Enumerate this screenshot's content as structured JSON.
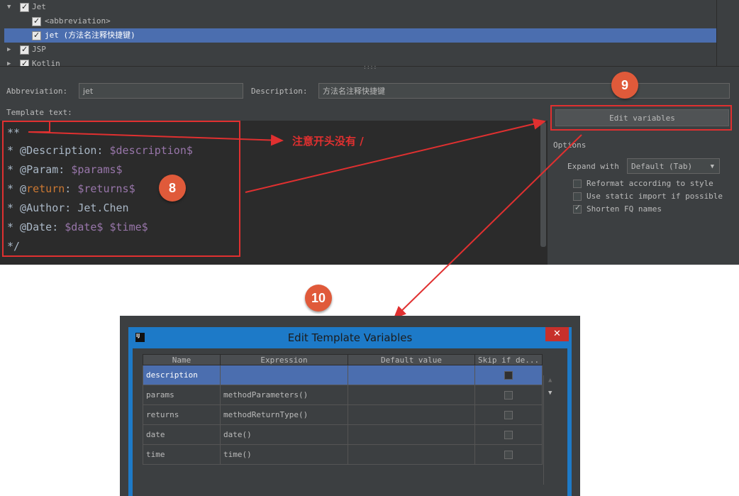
{
  "tree": {
    "items": [
      {
        "label": "Jet",
        "checked": true,
        "expanded": true
      },
      {
        "label": "<abbreviation>",
        "checked": true
      },
      {
        "label": "jet (方法名注释快捷键)",
        "checked": true,
        "selected": true
      },
      {
        "label": "JSP",
        "checked": true,
        "expanded": false
      },
      {
        "label": "Kotlin",
        "checked": true,
        "expanded": false
      }
    ],
    "divider_grip": "::::"
  },
  "form": {
    "abbreviation_label": "Abbreviation:",
    "abbreviation_value": "jet",
    "description_label": "Description:",
    "description_value": "方法名注释快捷键",
    "template_text_label": "Template text:"
  },
  "template": {
    "line1": "**",
    "line2_prefix": "* @Description: ",
    "line2_var": "$description$",
    "line3_prefix": "* @Param: ",
    "line3_var": "$params$",
    "line4_star": "* @",
    "line4_kw": "return",
    "line4_colon": ": ",
    "line4_var": "$returns$",
    "line5": "* @Author: Jet.Chen",
    "line6_prefix": "* @Date: ",
    "line6_var1": "$date$",
    "line6_var2": "$time$",
    "line7": "*/"
  },
  "options": {
    "edit_variables_button": "Edit variables",
    "section_title": "Options",
    "expand_with_label": "Expand with",
    "expand_with_value": "Default (Tab)",
    "checkboxes": [
      {
        "label": "Reformat according to style",
        "checked": false
      },
      {
        "label": "Use static import if possible",
        "checked": false
      },
      {
        "label": "Shorten FQ names",
        "checked": true
      }
    ]
  },
  "annotations": {
    "badge_8": "8",
    "badge_9": "9",
    "badge_10": "10",
    "note": "注意开头没有 /",
    "accent": "#e03030",
    "badge_color": "#e05a3a"
  },
  "dialog": {
    "title": "Edit Template Variables",
    "close": "✕",
    "app_icon": "IJ",
    "columns": [
      "Name",
      "Expression",
      "Default value",
      "Skip if de..."
    ],
    "rows": [
      {
        "name": "description",
        "expression": "",
        "default": "",
        "skip": false,
        "selected": true
      },
      {
        "name": "params",
        "expression": "methodParameters()",
        "default": "",
        "skip": false
      },
      {
        "name": "returns",
        "expression": "methodReturnType()",
        "default": "",
        "skip": false
      },
      {
        "name": "date",
        "expression": "date()",
        "default": "",
        "skip": false
      },
      {
        "name": "time",
        "expression": "time()",
        "default": "",
        "skip": false
      }
    ]
  },
  "colors": {
    "ide_bg": "#3c3f41",
    "editor_bg": "#2b2b2b",
    "selection": "#4b6eaf",
    "keyword": "#cc7832",
    "variable": "#9876aa",
    "dialog_frame": "#1d7ac8"
  }
}
